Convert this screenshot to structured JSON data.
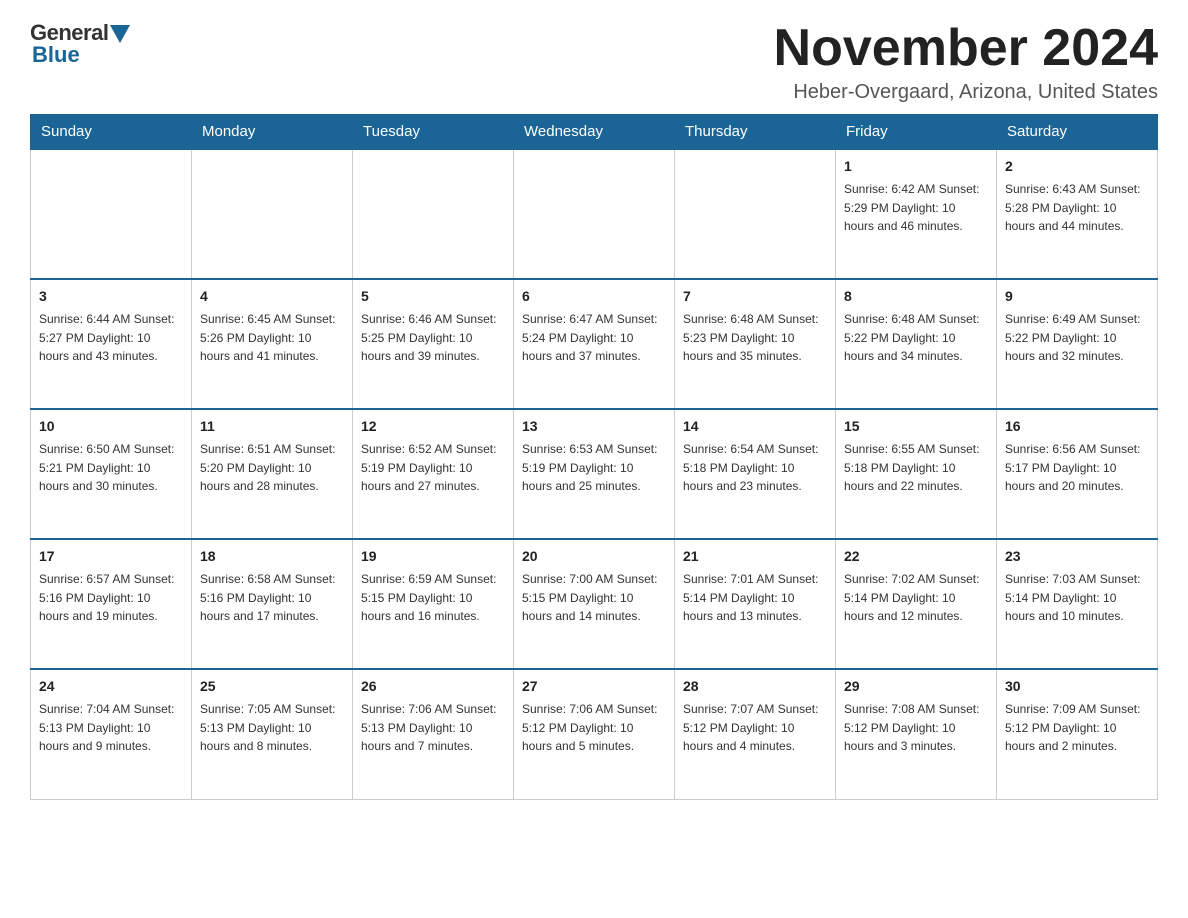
{
  "header": {
    "logo_general": "General",
    "logo_blue": "Blue",
    "month_title": "November 2024",
    "location": "Heber-Overgaard, Arizona, United States"
  },
  "weekdays": [
    "Sunday",
    "Monday",
    "Tuesday",
    "Wednesday",
    "Thursday",
    "Friday",
    "Saturday"
  ],
  "weeks": [
    [
      {
        "day": "",
        "info": ""
      },
      {
        "day": "",
        "info": ""
      },
      {
        "day": "",
        "info": ""
      },
      {
        "day": "",
        "info": ""
      },
      {
        "day": "",
        "info": ""
      },
      {
        "day": "1",
        "info": "Sunrise: 6:42 AM\nSunset: 5:29 PM\nDaylight: 10 hours and 46 minutes."
      },
      {
        "day": "2",
        "info": "Sunrise: 6:43 AM\nSunset: 5:28 PM\nDaylight: 10 hours and 44 minutes."
      }
    ],
    [
      {
        "day": "3",
        "info": "Sunrise: 6:44 AM\nSunset: 5:27 PM\nDaylight: 10 hours and 43 minutes."
      },
      {
        "day": "4",
        "info": "Sunrise: 6:45 AM\nSunset: 5:26 PM\nDaylight: 10 hours and 41 minutes."
      },
      {
        "day": "5",
        "info": "Sunrise: 6:46 AM\nSunset: 5:25 PM\nDaylight: 10 hours and 39 minutes."
      },
      {
        "day": "6",
        "info": "Sunrise: 6:47 AM\nSunset: 5:24 PM\nDaylight: 10 hours and 37 minutes."
      },
      {
        "day": "7",
        "info": "Sunrise: 6:48 AM\nSunset: 5:23 PM\nDaylight: 10 hours and 35 minutes."
      },
      {
        "day": "8",
        "info": "Sunrise: 6:48 AM\nSunset: 5:22 PM\nDaylight: 10 hours and 34 minutes."
      },
      {
        "day": "9",
        "info": "Sunrise: 6:49 AM\nSunset: 5:22 PM\nDaylight: 10 hours and 32 minutes."
      }
    ],
    [
      {
        "day": "10",
        "info": "Sunrise: 6:50 AM\nSunset: 5:21 PM\nDaylight: 10 hours and 30 minutes."
      },
      {
        "day": "11",
        "info": "Sunrise: 6:51 AM\nSunset: 5:20 PM\nDaylight: 10 hours and 28 minutes."
      },
      {
        "day": "12",
        "info": "Sunrise: 6:52 AM\nSunset: 5:19 PM\nDaylight: 10 hours and 27 minutes."
      },
      {
        "day": "13",
        "info": "Sunrise: 6:53 AM\nSunset: 5:19 PM\nDaylight: 10 hours and 25 minutes."
      },
      {
        "day": "14",
        "info": "Sunrise: 6:54 AM\nSunset: 5:18 PM\nDaylight: 10 hours and 23 minutes."
      },
      {
        "day": "15",
        "info": "Sunrise: 6:55 AM\nSunset: 5:18 PM\nDaylight: 10 hours and 22 minutes."
      },
      {
        "day": "16",
        "info": "Sunrise: 6:56 AM\nSunset: 5:17 PM\nDaylight: 10 hours and 20 minutes."
      }
    ],
    [
      {
        "day": "17",
        "info": "Sunrise: 6:57 AM\nSunset: 5:16 PM\nDaylight: 10 hours and 19 minutes."
      },
      {
        "day": "18",
        "info": "Sunrise: 6:58 AM\nSunset: 5:16 PM\nDaylight: 10 hours and 17 minutes."
      },
      {
        "day": "19",
        "info": "Sunrise: 6:59 AM\nSunset: 5:15 PM\nDaylight: 10 hours and 16 minutes."
      },
      {
        "day": "20",
        "info": "Sunrise: 7:00 AM\nSunset: 5:15 PM\nDaylight: 10 hours and 14 minutes."
      },
      {
        "day": "21",
        "info": "Sunrise: 7:01 AM\nSunset: 5:14 PM\nDaylight: 10 hours and 13 minutes."
      },
      {
        "day": "22",
        "info": "Sunrise: 7:02 AM\nSunset: 5:14 PM\nDaylight: 10 hours and 12 minutes."
      },
      {
        "day": "23",
        "info": "Sunrise: 7:03 AM\nSunset: 5:14 PM\nDaylight: 10 hours and 10 minutes."
      }
    ],
    [
      {
        "day": "24",
        "info": "Sunrise: 7:04 AM\nSunset: 5:13 PM\nDaylight: 10 hours and 9 minutes."
      },
      {
        "day": "25",
        "info": "Sunrise: 7:05 AM\nSunset: 5:13 PM\nDaylight: 10 hours and 8 minutes."
      },
      {
        "day": "26",
        "info": "Sunrise: 7:06 AM\nSunset: 5:13 PM\nDaylight: 10 hours and 7 minutes."
      },
      {
        "day": "27",
        "info": "Sunrise: 7:06 AM\nSunset: 5:12 PM\nDaylight: 10 hours and 5 minutes."
      },
      {
        "day": "28",
        "info": "Sunrise: 7:07 AM\nSunset: 5:12 PM\nDaylight: 10 hours and 4 minutes."
      },
      {
        "day": "29",
        "info": "Sunrise: 7:08 AM\nSunset: 5:12 PM\nDaylight: 10 hours and 3 minutes."
      },
      {
        "day": "30",
        "info": "Sunrise: 7:09 AM\nSunset: 5:12 PM\nDaylight: 10 hours and 2 minutes."
      }
    ]
  ]
}
